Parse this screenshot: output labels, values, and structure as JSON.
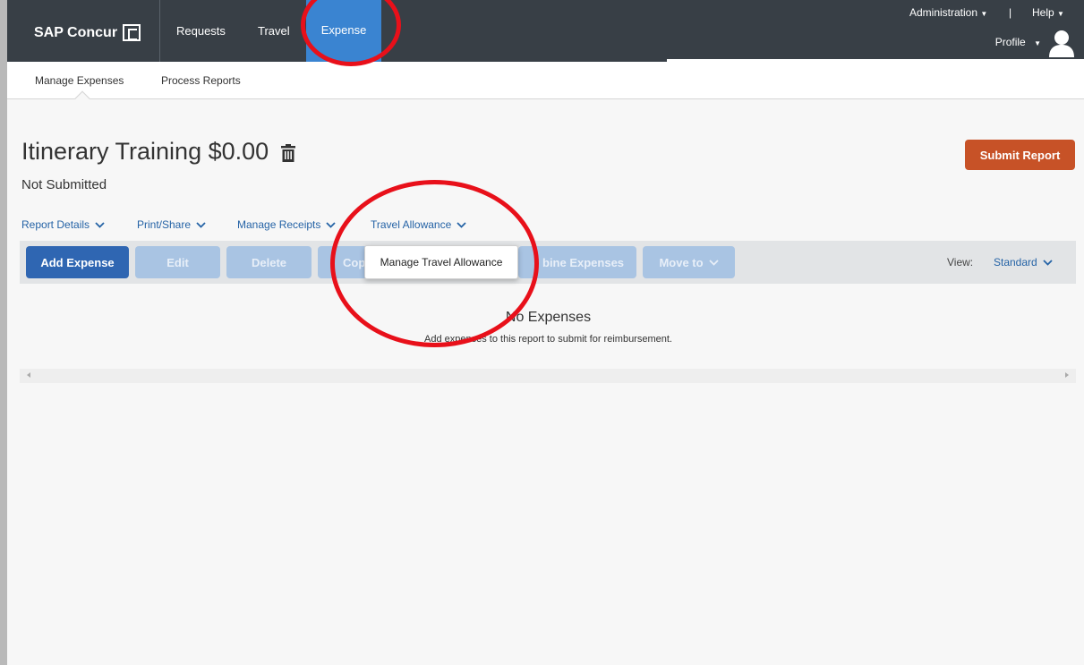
{
  "header": {
    "brand": "SAP Concur",
    "nav": [
      "Requests",
      "Travel",
      "Expense"
    ],
    "active_nav": "Expense",
    "administration": "Administration",
    "help": "Help",
    "separator": "|",
    "profile": "Profile"
  },
  "subnav": {
    "items": [
      "Manage Expenses",
      "Process Reports"
    ],
    "active": "Manage Expenses"
  },
  "report": {
    "title": "Itinerary Training $0.00",
    "status": "Not Submitted",
    "submit_label": "Submit Report"
  },
  "actions": [
    "Report Details",
    "Print/Share",
    "Manage Receipts",
    "Travel Allowance"
  ],
  "toolbar": {
    "add_expense": "Add Expense",
    "edit": "Edit",
    "delete": "Delete",
    "copy_partial": "Cop",
    "combine_partial": "bine Expenses",
    "move_to": "Move to",
    "view_label": "View:",
    "view_value": "Standard"
  },
  "dropdown": {
    "items": [
      "Manage Travel Allowance"
    ]
  },
  "empty_state": {
    "title": "No Expenses",
    "subtitle": "Add expenses to this report to submit for reimbursement."
  },
  "colors": {
    "header_bg": "#383f46",
    "active_tab": "#3a84d1",
    "primary_button": "#2f66b2",
    "submit_button": "#c75227",
    "annotation": "#e8101a",
    "link": "#2563a6"
  }
}
